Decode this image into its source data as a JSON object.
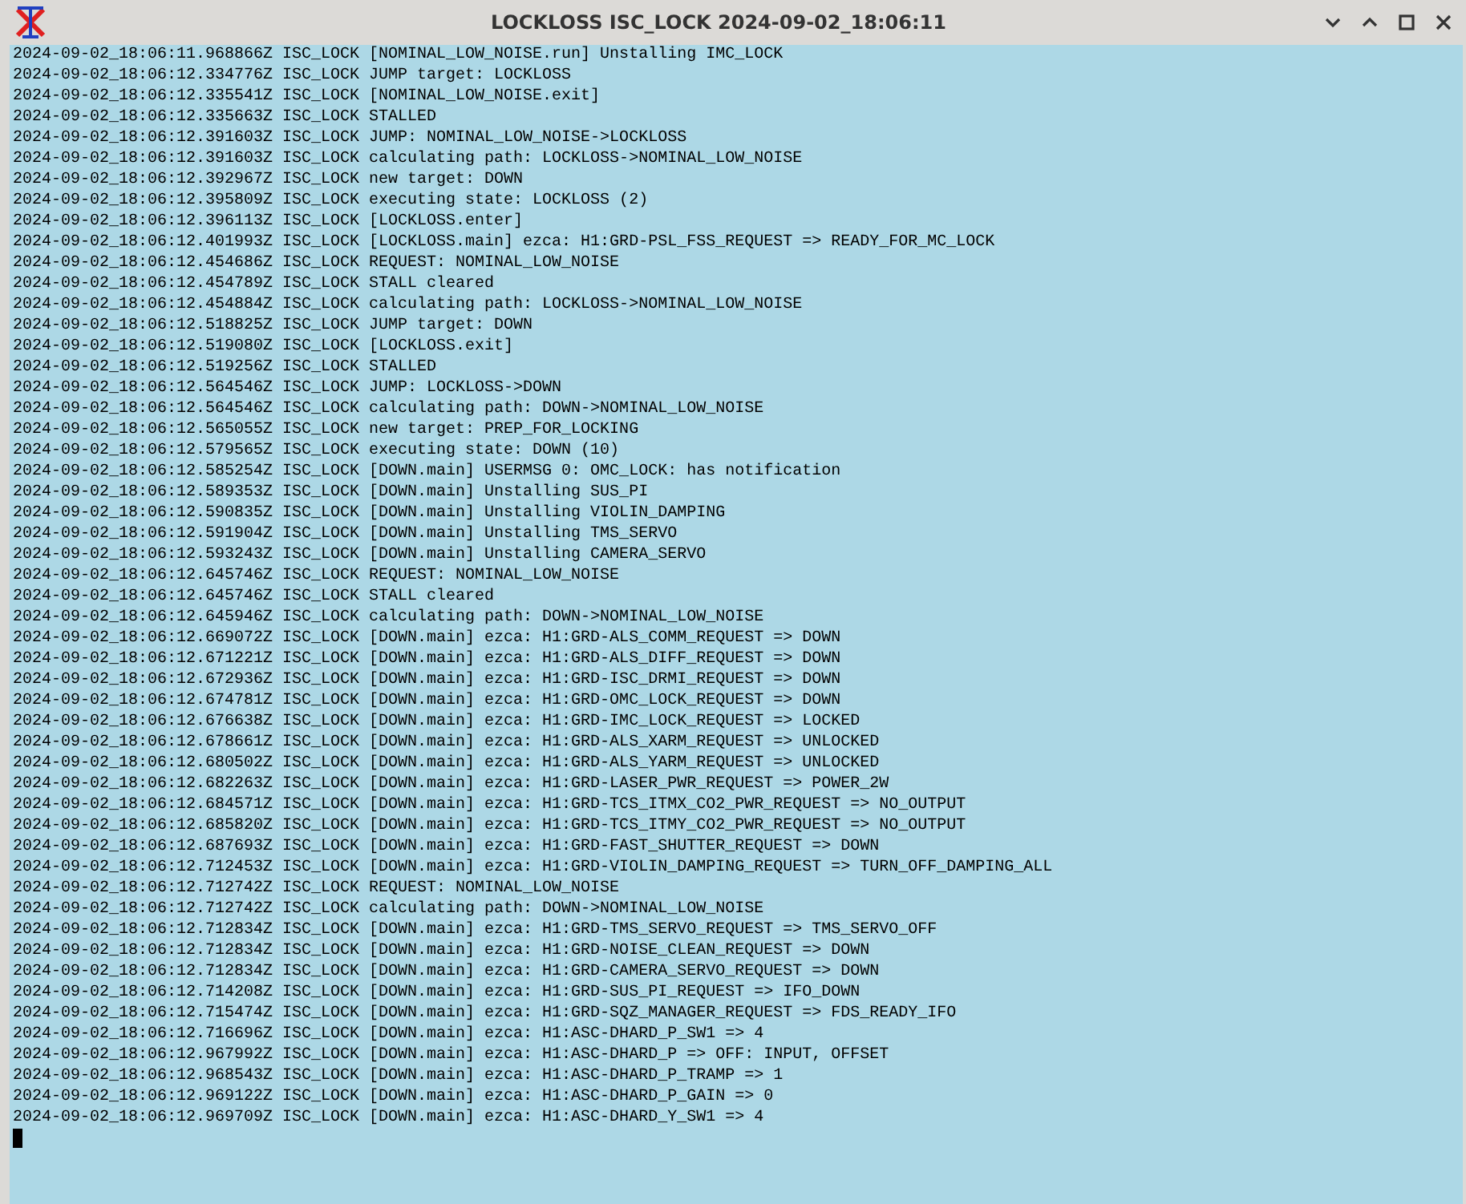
{
  "window": {
    "title": "LOCKLOSS ISC_LOCK 2024-09-02_18:06:11"
  },
  "log_lines": [
    "2024-09-02_18:06:11.968866Z ISC_LOCK [NOMINAL_LOW_NOISE.run] Unstalling IMC_LOCK",
    "2024-09-02_18:06:12.334776Z ISC_LOCK JUMP target: LOCKLOSS",
    "2024-09-02_18:06:12.335541Z ISC_LOCK [NOMINAL_LOW_NOISE.exit]",
    "2024-09-02_18:06:12.335663Z ISC_LOCK STALLED",
    "2024-09-02_18:06:12.391603Z ISC_LOCK JUMP: NOMINAL_LOW_NOISE->LOCKLOSS",
    "2024-09-02_18:06:12.391603Z ISC_LOCK calculating path: LOCKLOSS->NOMINAL_LOW_NOISE",
    "2024-09-02_18:06:12.392967Z ISC_LOCK new target: DOWN",
    "2024-09-02_18:06:12.395809Z ISC_LOCK executing state: LOCKLOSS (2)",
    "2024-09-02_18:06:12.396113Z ISC_LOCK [LOCKLOSS.enter]",
    "2024-09-02_18:06:12.401993Z ISC_LOCK [LOCKLOSS.main] ezca: H1:GRD-PSL_FSS_REQUEST => READY_FOR_MC_LOCK",
    "2024-09-02_18:06:12.454686Z ISC_LOCK REQUEST: NOMINAL_LOW_NOISE",
    "2024-09-02_18:06:12.454789Z ISC_LOCK STALL cleared",
    "2024-09-02_18:06:12.454884Z ISC_LOCK calculating path: LOCKLOSS->NOMINAL_LOW_NOISE",
    "2024-09-02_18:06:12.518825Z ISC_LOCK JUMP target: DOWN",
    "2024-09-02_18:06:12.519080Z ISC_LOCK [LOCKLOSS.exit]",
    "2024-09-02_18:06:12.519256Z ISC_LOCK STALLED",
    "2024-09-02_18:06:12.564546Z ISC_LOCK JUMP: LOCKLOSS->DOWN",
    "2024-09-02_18:06:12.564546Z ISC_LOCK calculating path: DOWN->NOMINAL_LOW_NOISE",
    "2024-09-02_18:06:12.565055Z ISC_LOCK new target: PREP_FOR_LOCKING",
    "2024-09-02_18:06:12.579565Z ISC_LOCK executing state: DOWN (10)",
    "2024-09-02_18:06:12.585254Z ISC_LOCK [DOWN.main] USERMSG 0: OMC_LOCK: has notification",
    "2024-09-02_18:06:12.589353Z ISC_LOCK [DOWN.main] Unstalling SUS_PI",
    "2024-09-02_18:06:12.590835Z ISC_LOCK [DOWN.main] Unstalling VIOLIN_DAMPING",
    "2024-09-02_18:06:12.591904Z ISC_LOCK [DOWN.main] Unstalling TMS_SERVO",
    "2024-09-02_18:06:12.593243Z ISC_LOCK [DOWN.main] Unstalling CAMERA_SERVO",
    "2024-09-02_18:06:12.645746Z ISC_LOCK REQUEST: NOMINAL_LOW_NOISE",
    "2024-09-02_18:06:12.645746Z ISC_LOCK STALL cleared",
    "2024-09-02_18:06:12.645946Z ISC_LOCK calculating path: DOWN->NOMINAL_LOW_NOISE",
    "2024-09-02_18:06:12.669072Z ISC_LOCK [DOWN.main] ezca: H1:GRD-ALS_COMM_REQUEST => DOWN",
    "2024-09-02_18:06:12.671221Z ISC_LOCK [DOWN.main] ezca: H1:GRD-ALS_DIFF_REQUEST => DOWN",
    "2024-09-02_18:06:12.672936Z ISC_LOCK [DOWN.main] ezca: H1:GRD-ISC_DRMI_REQUEST => DOWN",
    "2024-09-02_18:06:12.674781Z ISC_LOCK [DOWN.main] ezca: H1:GRD-OMC_LOCK_REQUEST => DOWN",
    "2024-09-02_18:06:12.676638Z ISC_LOCK [DOWN.main] ezca: H1:GRD-IMC_LOCK_REQUEST => LOCKED",
    "2024-09-02_18:06:12.678661Z ISC_LOCK [DOWN.main] ezca: H1:GRD-ALS_XARM_REQUEST => UNLOCKED",
    "2024-09-02_18:06:12.680502Z ISC_LOCK [DOWN.main] ezca: H1:GRD-ALS_YARM_REQUEST => UNLOCKED",
    "2024-09-02_18:06:12.682263Z ISC_LOCK [DOWN.main] ezca: H1:GRD-LASER_PWR_REQUEST => POWER_2W",
    "2024-09-02_18:06:12.684571Z ISC_LOCK [DOWN.main] ezca: H1:GRD-TCS_ITMX_CO2_PWR_REQUEST => NO_OUTPUT",
    "2024-09-02_18:06:12.685820Z ISC_LOCK [DOWN.main] ezca: H1:GRD-TCS_ITMY_CO2_PWR_REQUEST => NO_OUTPUT",
    "2024-09-02_18:06:12.687693Z ISC_LOCK [DOWN.main] ezca: H1:GRD-FAST_SHUTTER_REQUEST => DOWN",
    "2024-09-02_18:06:12.712453Z ISC_LOCK [DOWN.main] ezca: H1:GRD-VIOLIN_DAMPING_REQUEST => TURN_OFF_DAMPING_ALL",
    "2024-09-02_18:06:12.712742Z ISC_LOCK REQUEST: NOMINAL_LOW_NOISE",
    "2024-09-02_18:06:12.712742Z ISC_LOCK calculating path: DOWN->NOMINAL_LOW_NOISE",
    "2024-09-02_18:06:12.712834Z ISC_LOCK [DOWN.main] ezca: H1:GRD-TMS_SERVO_REQUEST => TMS_SERVO_OFF",
    "2024-09-02_18:06:12.712834Z ISC_LOCK [DOWN.main] ezca: H1:GRD-NOISE_CLEAN_REQUEST => DOWN",
    "2024-09-02_18:06:12.712834Z ISC_LOCK [DOWN.main] ezca: H1:GRD-CAMERA_SERVO_REQUEST => DOWN",
    "2024-09-02_18:06:12.714208Z ISC_LOCK [DOWN.main] ezca: H1:GRD-SUS_PI_REQUEST => IFO_DOWN",
    "2024-09-02_18:06:12.715474Z ISC_LOCK [DOWN.main] ezca: H1:GRD-SQZ_MANAGER_REQUEST => FDS_READY_IFO",
    "2024-09-02_18:06:12.716696Z ISC_LOCK [DOWN.main] ezca: H1:ASC-DHARD_P_SW1 => 4",
    "2024-09-02_18:06:12.967992Z ISC_LOCK [DOWN.main] ezca: H1:ASC-DHARD_P => OFF: INPUT, OFFSET",
    "2024-09-02_18:06:12.968543Z ISC_LOCK [DOWN.main] ezca: H1:ASC-DHARD_P_TRAMP => 1",
    "2024-09-02_18:06:12.969122Z ISC_LOCK [DOWN.main] ezca: H1:ASC-DHARD_P_GAIN => 0",
    "2024-09-02_18:06:12.969709Z ISC_LOCK [DOWN.main] ezca: H1:ASC-DHARD_Y_SW1 => 4"
  ]
}
